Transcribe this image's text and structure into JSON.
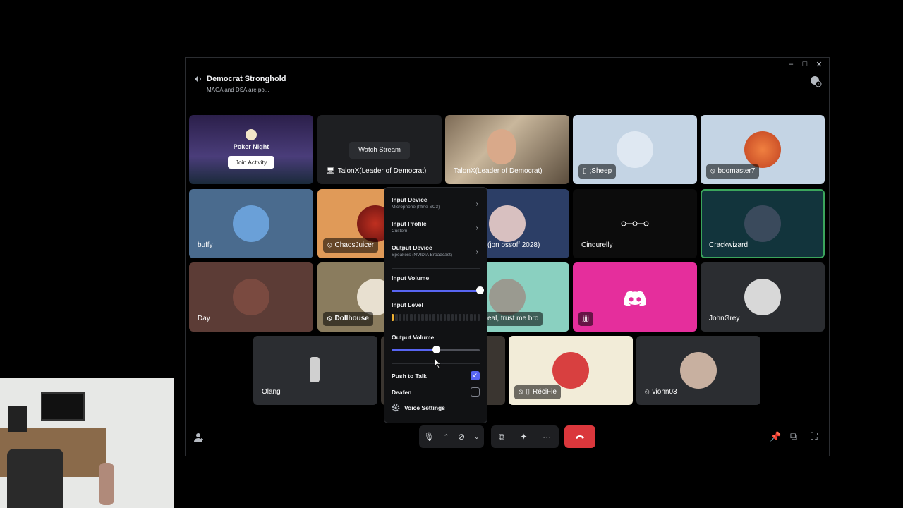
{
  "header": {
    "title": "Democrat Stronghold",
    "subtitle": "MAGA and DSA are po..."
  },
  "window_controls": {
    "minimize": "–",
    "maximize": "□",
    "close": "✕"
  },
  "activity": {
    "title": "Poker Night",
    "button": "Join Activity"
  },
  "stream": {
    "button": "Watch Stream"
  },
  "tiles": {
    "talonx1": "TalonX(Leader of Democrat)",
    "talonx2": "TalonX(Leader of Democrat)",
    "sheep": ";Sheep",
    "boomaster": "boomaster7",
    "buffy": "buffy",
    "chaosjuicer": "ChaosJuicer",
    "jonossoff": "(jon ossoff 2028)",
    "cindurelly": "Cindurelly",
    "crackwizard": "Crackwizard",
    "day": "Day",
    "dollhouse": "Dollhouse",
    "trustme": "eal, trust me bro",
    "jjjj": "jjjj",
    "johngrey": "JohnGrey",
    "olang": "Olang",
    "recifie": "RéciFie",
    "vionn": "vionn03"
  },
  "popup": {
    "input_device": {
      "label": "Input Device",
      "value": "Microphone (fifine SC3)"
    },
    "input_profile": {
      "label": "Input Profile",
      "value": "Custom"
    },
    "output_device": {
      "label": "Output Device",
      "value": "Speakers (NVIDIA Broadcast)"
    },
    "input_volume": {
      "label": "Input Volume",
      "level": 1.0
    },
    "input_level": {
      "label": "Input Level",
      "active_bars": 1,
      "total_bars": 24
    },
    "output_volume": {
      "label": "Output Volume",
      "level": 0.5
    },
    "push_to_talk": {
      "label": "Push to Talk",
      "checked": true
    },
    "deafen": {
      "label": "Deafen",
      "checked": false
    },
    "voice_settings": "Voice Settings"
  },
  "colors": {
    "accent": "#5865f2",
    "danger": "#da373c",
    "speaking": "#3ba55c"
  }
}
